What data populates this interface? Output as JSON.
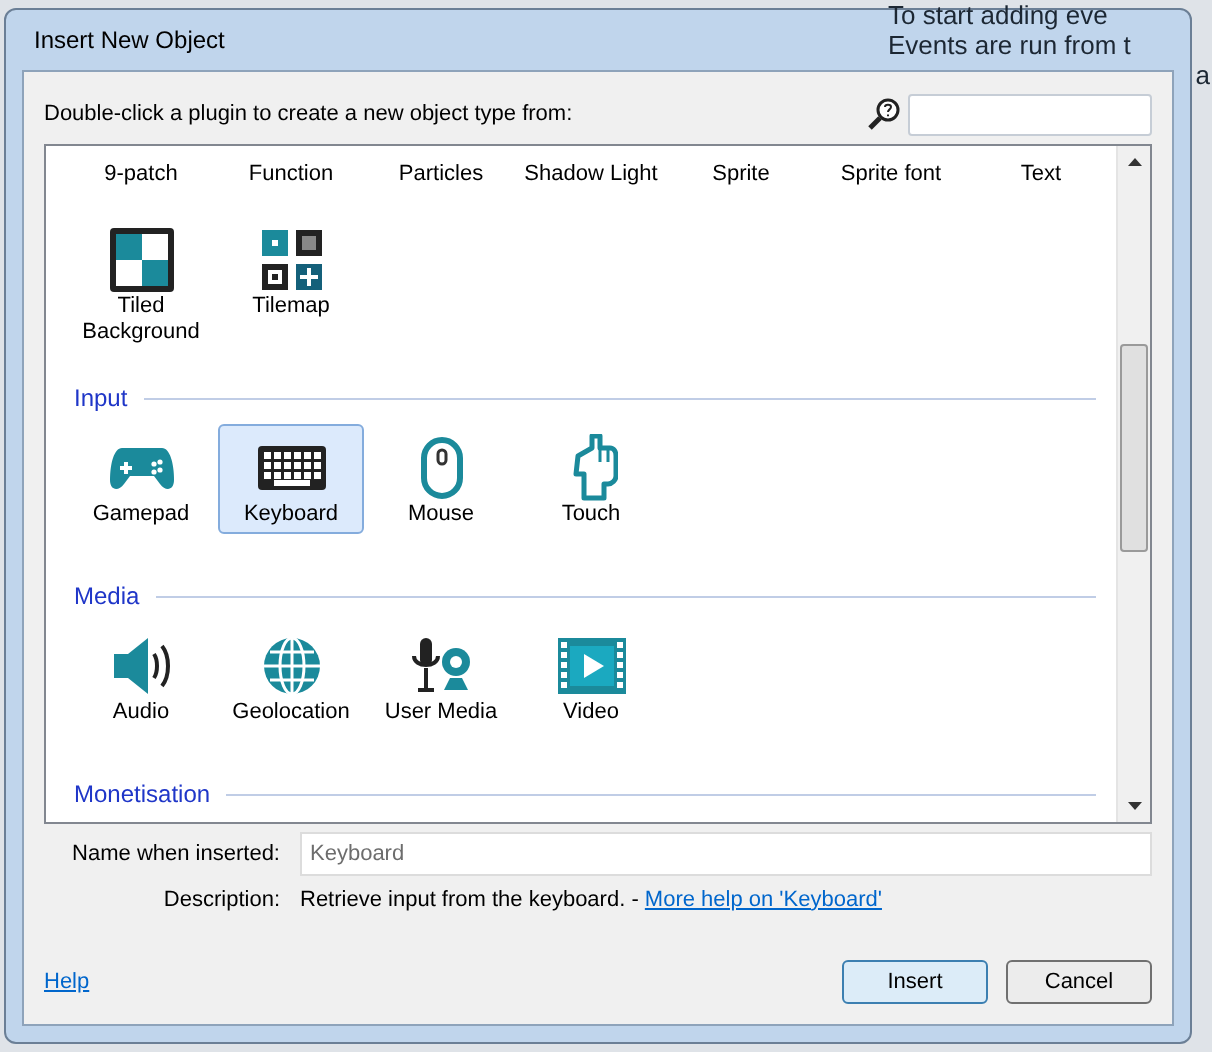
{
  "window": {
    "title": "Insert New Object"
  },
  "background_text": [
    "To start adding eve",
    "Events are run from t",
    "a"
  ],
  "prompt": "Double-click a plugin to create a new object type from:",
  "sections": [
    {
      "items": [
        {
          "label": "9-patch",
          "kind": "label_only",
          "selected": false
        },
        {
          "label": "Function",
          "kind": "label_only",
          "selected": false
        },
        {
          "label": "Particles",
          "kind": "label_only",
          "selected": false
        },
        {
          "label": "Shadow Light",
          "kind": "label_only",
          "selected": false
        },
        {
          "label": "Sprite",
          "kind": "label_only",
          "selected": false
        },
        {
          "label": "Sprite font",
          "kind": "label_only",
          "selected": false
        },
        {
          "label": "Text",
          "kind": "label_only",
          "selected": false
        },
        {
          "label": "Tiled Background",
          "kind": "icon",
          "selected": false
        },
        {
          "label": "Tilemap",
          "kind": "icon",
          "selected": false
        }
      ]
    },
    {
      "title": "Input",
      "items": [
        {
          "label": "Gamepad",
          "kind": "icon",
          "selected": false
        },
        {
          "label": "Keyboard",
          "kind": "icon",
          "selected": true
        },
        {
          "label": "Mouse",
          "kind": "icon",
          "selected": false
        },
        {
          "label": "Touch",
          "kind": "icon",
          "selected": false
        }
      ]
    },
    {
      "title": "Media",
      "items": [
        {
          "label": "Audio",
          "kind": "icon",
          "selected": false
        },
        {
          "label": "Geolocation",
          "kind": "icon",
          "selected": false
        },
        {
          "label": "User Media",
          "kind": "icon",
          "selected": false
        },
        {
          "label": "Video",
          "kind": "icon",
          "selected": false
        }
      ]
    },
    {
      "title": "Monetisation"
    }
  ],
  "name_field": {
    "label": "Name when inserted:",
    "value": "Keyboard"
  },
  "description": {
    "label": "Description:",
    "text": "Retrieve input from the keyboard. - ",
    "link": "More help on 'Keyboard'"
  },
  "help_link": "Help",
  "buttons": [
    {
      "label": "Insert",
      "default": true
    },
    {
      "label": "Cancel",
      "default": false
    }
  ]
}
